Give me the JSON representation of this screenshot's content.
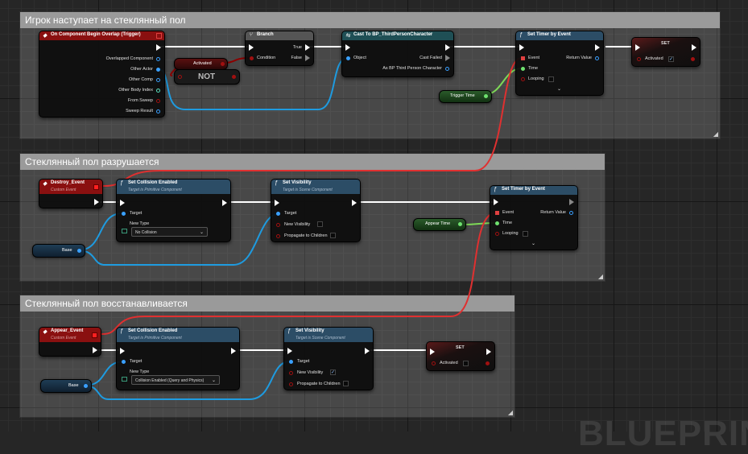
{
  "comments": {
    "c1": "Игрок наступает на стеклянный пол",
    "c2": "Стеклянный пол разрушается",
    "c3": "Стеклянный пол восстанавливается"
  },
  "overlap_node": {
    "title": "On Component Begin Overlap (Trigger)",
    "pins": [
      "Overlapped Component",
      "Other Actor",
      "Other Comp",
      "Other Body Index",
      "From Sweep",
      "Sweep Result"
    ]
  },
  "activated_getter": "Activated",
  "not_node": "NOT",
  "branch_node": {
    "title": "Branch",
    "condition": "Condition",
    "true": "True",
    "false": "False"
  },
  "cast_node": {
    "title": "Cast To BP_ThirdPersonCharacter",
    "object": "Object",
    "cast_failed": "Cast Failed",
    "as_output": "As BP Third Person Character"
  },
  "timer1": {
    "title": "Set Timer by Event",
    "event": "Event",
    "time": "Time",
    "looping": "Looping",
    "return_value": "Return Value"
  },
  "trigger_time": "Trigger Time",
  "set1": {
    "title": "SET",
    "activated": "Activated"
  },
  "destroy_event": {
    "title": "Destroy_Event",
    "sub": "Custom Event"
  },
  "collision1": {
    "title": "Set Collision Enabled",
    "sub": "Target is Primitive Component",
    "target": "Target",
    "new_type": "New Type",
    "value": "No Collision"
  },
  "visibility1": {
    "title": "Set Visibility",
    "sub": "Target is Scene Component",
    "target": "Target",
    "new_visibility": "New Visibility",
    "propagate": "Propagate to Children"
  },
  "timer2": {
    "title": "Set Timer by Event",
    "event": "Event",
    "time": "Time",
    "looping": "Looping",
    "return_value": "Return Value"
  },
  "appear_time": "Appear Time",
  "base1": "Base",
  "appear_event": {
    "title": "Appear_Event",
    "sub": "Custom Event"
  },
  "collision2": {
    "title": "Set Collision Enabled",
    "sub": "Target is Primitive Component",
    "target": "Target",
    "new_type": "New Type",
    "value": "Collision Enabled (Query and Physics)"
  },
  "visibility2": {
    "title": "Set Visibility",
    "sub": "Target is Scene Component",
    "target": "Target",
    "new_visibility": "New Visibility",
    "propagate": "Propagate to Children"
  },
  "set2": {
    "title": "SET",
    "activated": "Activated"
  },
  "base2": "Base",
  "watermark": "BLUEPRINT",
  "colors": {
    "exec": "#ffffff",
    "bool_wire": "#8b0000",
    "object_wire": "#1e9be0",
    "float_wire": "#7ed957",
    "event_wire": "#e03030",
    "event_header": "#8a1010",
    "function_header": "#2c4d66",
    "cast_header": "#1f4f55",
    "branch_header": "#555555"
  }
}
